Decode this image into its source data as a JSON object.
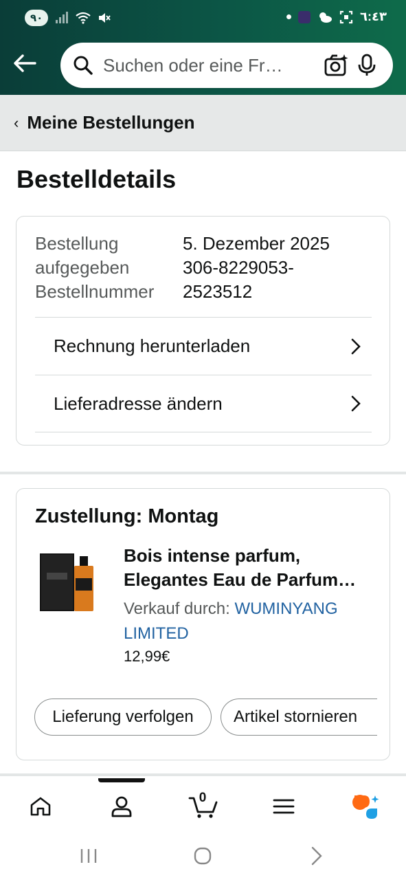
{
  "status_bar": {
    "left_pill": "٩٠",
    "time": "٦:٤٣"
  },
  "search": {
    "placeholder": "Suchen oder eine Fr…"
  },
  "breadcrumb": {
    "label": "Meine Bestellungen"
  },
  "page": {
    "title": "Bestelldetails"
  },
  "order_info": {
    "labels": [
      "Bestellung",
      "aufgegeben",
      "Bestellnummer"
    ],
    "values": [
      "5. Dezember 2025",
      "306-8229053-",
      "2523512"
    ],
    "actions": [
      {
        "label": "Rechnung herunterladen"
      },
      {
        "label": "Lieferadresse ändern"
      }
    ]
  },
  "shipment": {
    "heading": "Zustellung: Montag",
    "product": {
      "name_line1": "Bois intense parfum,",
      "name_line2": "Elegantes Eau de Parfum…",
      "seller_prefix": "Verkauf durch: ",
      "seller_name_line1": "WUMINYANG",
      "seller_name_line2": "LIMITED",
      "price": "12,99€"
    },
    "buttons": {
      "track": "Lieferung verfolgen",
      "cancel": "Artikel stornieren"
    }
  },
  "bottom_nav": {
    "cart_count": "0",
    "items": [
      "home-icon",
      "account-icon",
      "cart-icon",
      "menu-icon",
      "rufus-icon"
    ],
    "accent_orange": "#ff6a13",
    "accent_blue": "#1fa0e4"
  },
  "colors": {
    "header_green": "#0c5646",
    "link_blue": "#2162a1",
    "text_primary": "#0f1111",
    "text_secondary": "#565959"
  }
}
